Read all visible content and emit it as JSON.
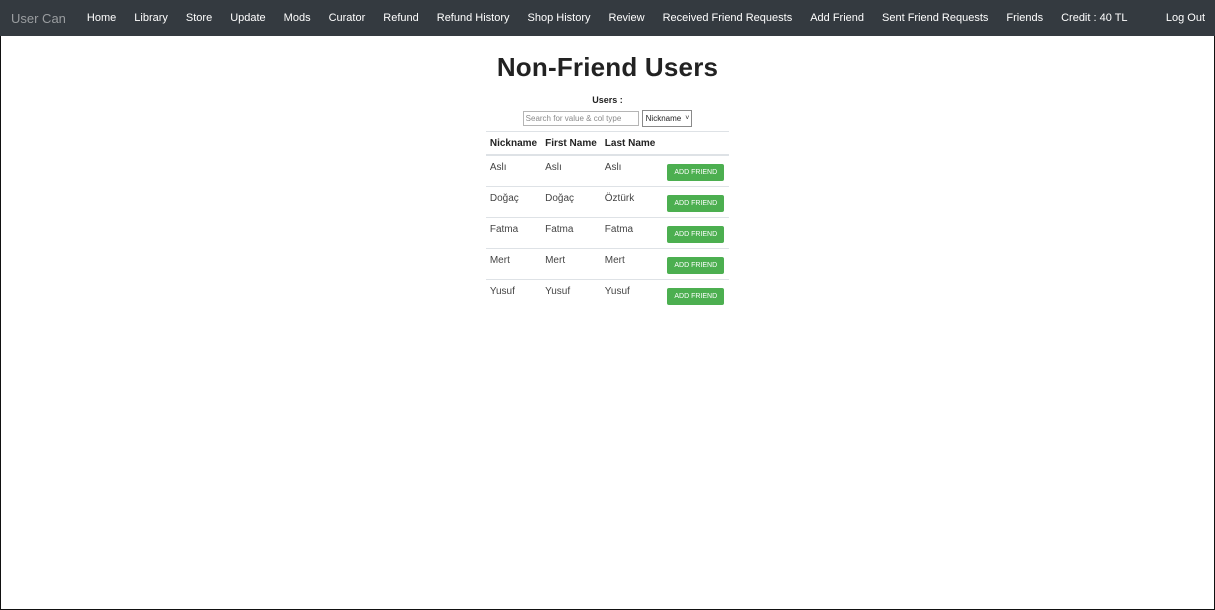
{
  "navbar": {
    "brand": "User Can",
    "links": [
      "Home",
      "Library",
      "Store",
      "Update",
      "Mods",
      "Curator",
      "Refund",
      "Refund History",
      "Shop History",
      "Review",
      "Received Friend Requests",
      "Add Friend",
      "Sent Friend Requests",
      "Friends",
      "Credit : 40 TL"
    ],
    "logout": "Log Out"
  },
  "page": {
    "title": "Non-Friend Users",
    "users_label": "Users :"
  },
  "search": {
    "placeholder": "Search for value & col type",
    "column_selected": "Nickname"
  },
  "table": {
    "headers": [
      "Nickname",
      "First Name",
      "Last Name"
    ],
    "rows": [
      {
        "nickname": "Aslı",
        "first_name": "Aslı",
        "last_name": "Aslı",
        "action": "ADD FRIEND"
      },
      {
        "nickname": "Doğaç",
        "first_name": "Doğaç",
        "last_name": "Öztürk",
        "action": "ADD FRIEND"
      },
      {
        "nickname": "Fatma",
        "first_name": "Fatma",
        "last_name": "Fatma",
        "action": "ADD FRIEND"
      },
      {
        "nickname": "Mert",
        "first_name": "Mert",
        "last_name": "Mert",
        "action": "ADD FRIEND"
      },
      {
        "nickname": "Yusuf",
        "first_name": "Yusuf",
        "last_name": "Yusuf",
        "action": "ADD FRIEND"
      }
    ]
  },
  "colors": {
    "navbar_bg": "#343a40",
    "button_green": "#4caf50"
  }
}
